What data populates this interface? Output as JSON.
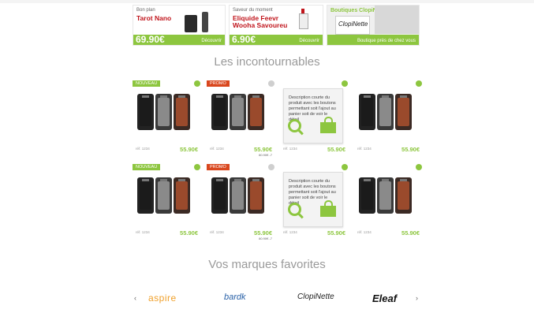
{
  "banners": [
    {
      "small": "Bon plan",
      "name": "Tarot Nano",
      "price": "69.90€",
      "link": "Découvrir"
    },
    {
      "small": "Saveur du moment",
      "name": "Eliquide Feevr Wooha Savoureu",
      "price": "6.90€",
      "link": "Découvrir"
    },
    {
      "small": "Boutiques ClopiNette",
      "name": "",
      "price": "",
      "link": "Boutique près de chez vous",
      "logo": "ClopiNette"
    }
  ],
  "section_titles": {
    "incontournables": "Les incontournables",
    "marques": "Vos marques favorites"
  },
  "products": [
    {
      "badge": "NOUVEAU",
      "badge_color": "green",
      "dot": "green",
      "ref": "réf. 1234",
      "price": "55.90€",
      "old": "",
      "type": "mods"
    },
    {
      "badge": "PROMO",
      "badge_color": "red",
      "dot": "grey",
      "ref": "réf. 1234",
      "price": "55.90€",
      "old": "80.90€ -7",
      "type": "mods"
    },
    {
      "badge": "",
      "badge_color": "",
      "dot": "green",
      "ref": "réf. 1234",
      "price": "55.90€",
      "old": "",
      "type": "desc",
      "desc": "Description courte du produit avec les boutons permettant soit l'ajout au panier soit de voir le détail"
    },
    {
      "badge": "",
      "badge_color": "",
      "dot": "green",
      "ref": "réf. 1234",
      "price": "55.90€",
      "old": "",
      "type": "mods"
    },
    {
      "badge": "NOUVEAU",
      "badge_color": "green",
      "dot": "green",
      "ref": "réf. 1234",
      "price": "55.90€",
      "old": "",
      "type": "mods"
    },
    {
      "badge": "PROMO",
      "badge_color": "red",
      "dot": "grey",
      "ref": "réf. 1234",
      "price": "55.90€",
      "old": "80.90€ -7",
      "type": "mods"
    },
    {
      "badge": "",
      "badge_color": "",
      "dot": "green",
      "ref": "réf. 1234",
      "price": "55.90€",
      "old": "",
      "type": "desc",
      "desc": "Description courte du produit avec les boutons permettant soit l'ajout au panier soit de voir le détail"
    },
    {
      "badge": "",
      "badge_color": "",
      "dot": "green",
      "ref": "réf. 1234",
      "price": "55.90€",
      "old": "",
      "type": "mods"
    }
  ],
  "brands": [
    "aspire",
    "bardk",
    "ClopiNette",
    "Eleaf"
  ],
  "nav": {
    "prev": "‹",
    "next": "›"
  },
  "colors": {
    "accent": "#8dc63f",
    "promo": "#d9471e",
    "title_grey": "#9a9a9a"
  }
}
